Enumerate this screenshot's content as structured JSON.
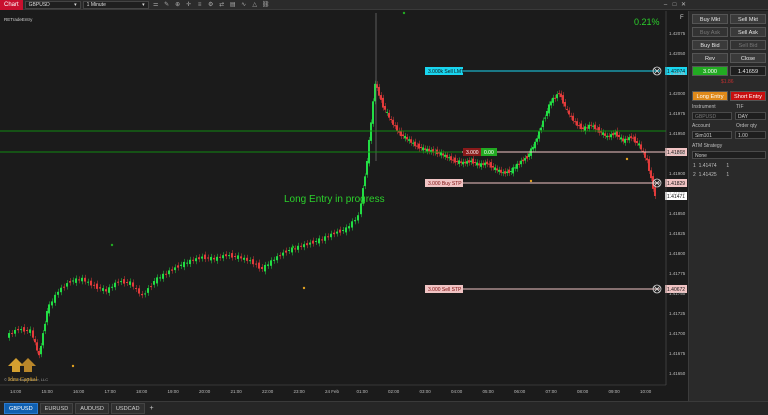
{
  "topbar": {
    "chart_tab": "Chart",
    "instrument": "GBPUSD",
    "interval": "1 Minute"
  },
  "chart": {
    "indicator_label": "RETradeEntry",
    "percent_readout": "0.21%",
    "corner_label": "F",
    "status_text": "Long Entry in progress",
    "copyright": "© 2021 NinjaTrader, LLC",
    "logo_text": "Idea Capital",
    "price_axis": [
      "1.42075",
      "1.42050",
      "1.42025",
      "1.42000",
      "1.41975",
      "1.41950",
      "1.41925",
      "1.41900",
      "1.41875",
      "1.41850",
      "1.41825",
      "1.41800",
      "1.41775",
      "1.41750",
      "1.41725",
      "1.41700",
      "1.41675",
      "1.41650"
    ],
    "time_axis": [
      "14:00",
      "15:00",
      "16:00",
      "17:00",
      "18:00",
      "19:00",
      "20:00",
      "21:00",
      "22:00",
      "23:00",
      "24 Feb",
      "01:00",
      "02:00",
      "03:00",
      "04:00",
      "05:00",
      "06:00",
      "07:00",
      "08:00",
      "09:00",
      "10:00"
    ],
    "orders": [
      {
        "label": "3.000k  Sell LMT",
        "price": "1.42074"
      },
      {
        "label": "3.000  Buy STP",
        "price": "1.41829"
      },
      {
        "label": "3.000  Sell STP",
        "price": "1.40672"
      }
    ],
    "price_tags": {
      "entry": "1.41868",
      "position_left": "3.000",
      "position_right": "0.00",
      "current": "1.41471"
    },
    "colors": {
      "up_candle": "#22dd44",
      "down_candle": "#e23b3b",
      "sell_lmt": "#19d6f0",
      "stop": "#f1c4c4",
      "green_line": "#118a11",
      "status": "#2bd12b"
    }
  },
  "panel": {
    "buy_mkt": "Buy Mkt",
    "sell_mkt": "Sell Mkt",
    "buy_ask": "Buy Ask",
    "sell_ask": "Sell Ask",
    "buy_bid": "Buy Bid",
    "sell_bid": "Sell Bid",
    "rev": "Rev",
    "close": "Close",
    "position_qty": "3.000",
    "position_price": "1.41659",
    "pnl": "$1.86",
    "long_entry": "Long Entry",
    "short_entry": "Short Entry",
    "instrument_label": "Instrument",
    "tif_label": "TIF",
    "instrument_value": "GBPUSD",
    "tif_value": "DAY",
    "account_label": "Account",
    "order_qty_label": "Order qty",
    "account_value": "Sim101",
    "order_qty_value": "1.00",
    "atm_label": "ATM Strategy",
    "atm_value": "None",
    "atm_rows": [
      {
        "id": "1",
        "price": "1.41474",
        "qty": "1"
      },
      {
        "id": "2",
        "price": "1.41425",
        "qty": "1"
      }
    ]
  },
  "tabs": [
    "GBPUSD",
    "EURUSD",
    "AUDUSD",
    "USDCAD"
  ]
}
